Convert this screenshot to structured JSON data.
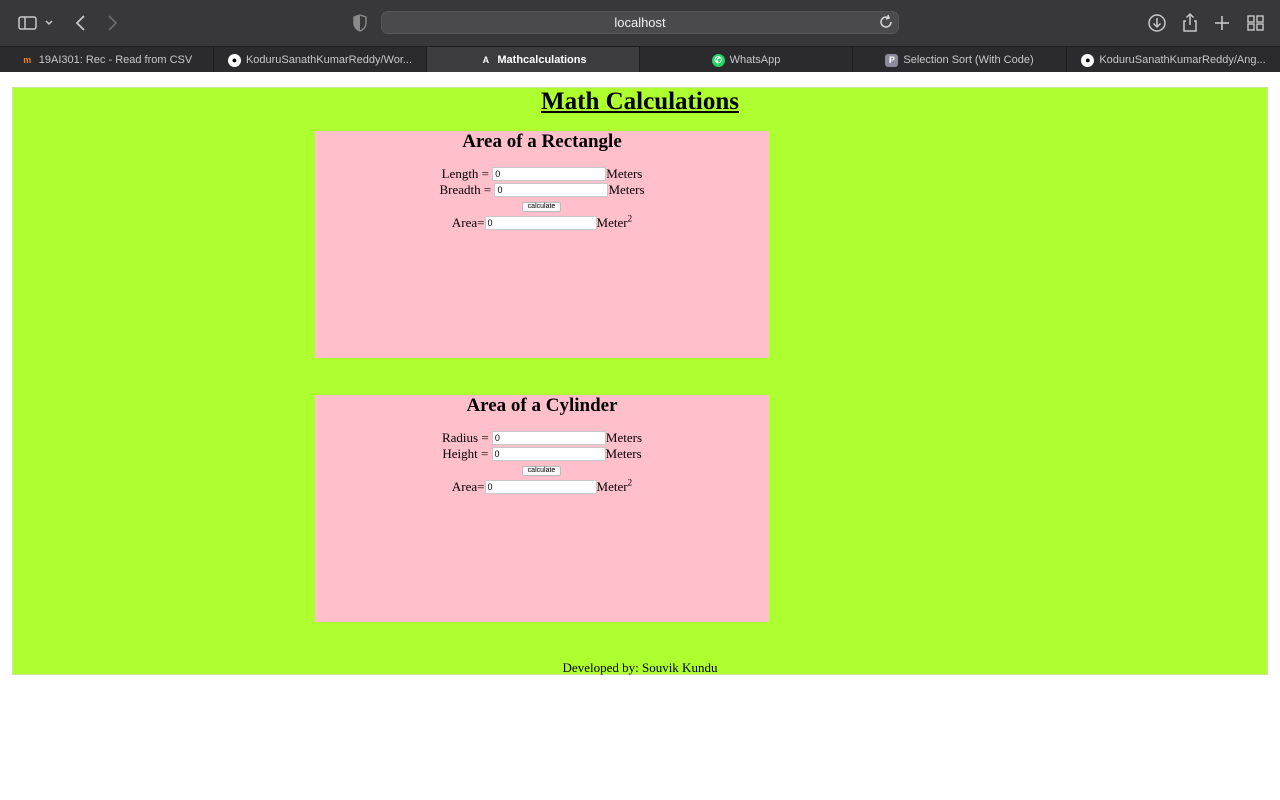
{
  "browser": {
    "url": "localhost",
    "tabs": [
      {
        "label": "19AI301: Rec - Read from CSV",
        "icon": "moodle-icon",
        "active": false
      },
      {
        "label": "KoduruSanathKumarReddy/Wor...",
        "icon": "github-icon",
        "active": false
      },
      {
        "label": "Mathcalculations",
        "icon": "angular-icon",
        "active": true
      },
      {
        "label": "WhatsApp",
        "icon": "whatsapp-icon",
        "active": false
      },
      {
        "label": "Selection Sort (With Code)",
        "icon": "programiz-icon",
        "active": false
      },
      {
        "label": "KoduruSanathKumarReddy/Ang...",
        "icon": "github-icon",
        "active": false
      }
    ]
  },
  "page": {
    "title": "Math Calculations",
    "rectangle": {
      "heading": "Area of a Rectangle",
      "length_label": "Length =",
      "length_value": "0",
      "length_unit": "Meters",
      "breadth_label": "Breadth =",
      "breadth_value": "0",
      "breadth_unit": "Meters",
      "button_label": "calculate",
      "area_label": "Area=",
      "area_value": "0",
      "area_unit": "Meter",
      "area_exp": "2"
    },
    "cylinder": {
      "heading": "Area of a Cylinder",
      "radius_label": "Radius =",
      "radius_value": "0",
      "radius_unit": "Meters",
      "height_label": "Height =",
      "height_value": "0",
      "height_unit": "Meters",
      "button_label": "calculate",
      "area_label": "Area=",
      "area_value": "0",
      "area_unit": "Meter",
      "area_exp": "2"
    },
    "footer": "Developed by: Souvik Kundu"
  },
  "colors": {
    "main_bg": "#adff2f",
    "card_bg": "#ffc0cb",
    "chrome_bg": "#38383a"
  }
}
